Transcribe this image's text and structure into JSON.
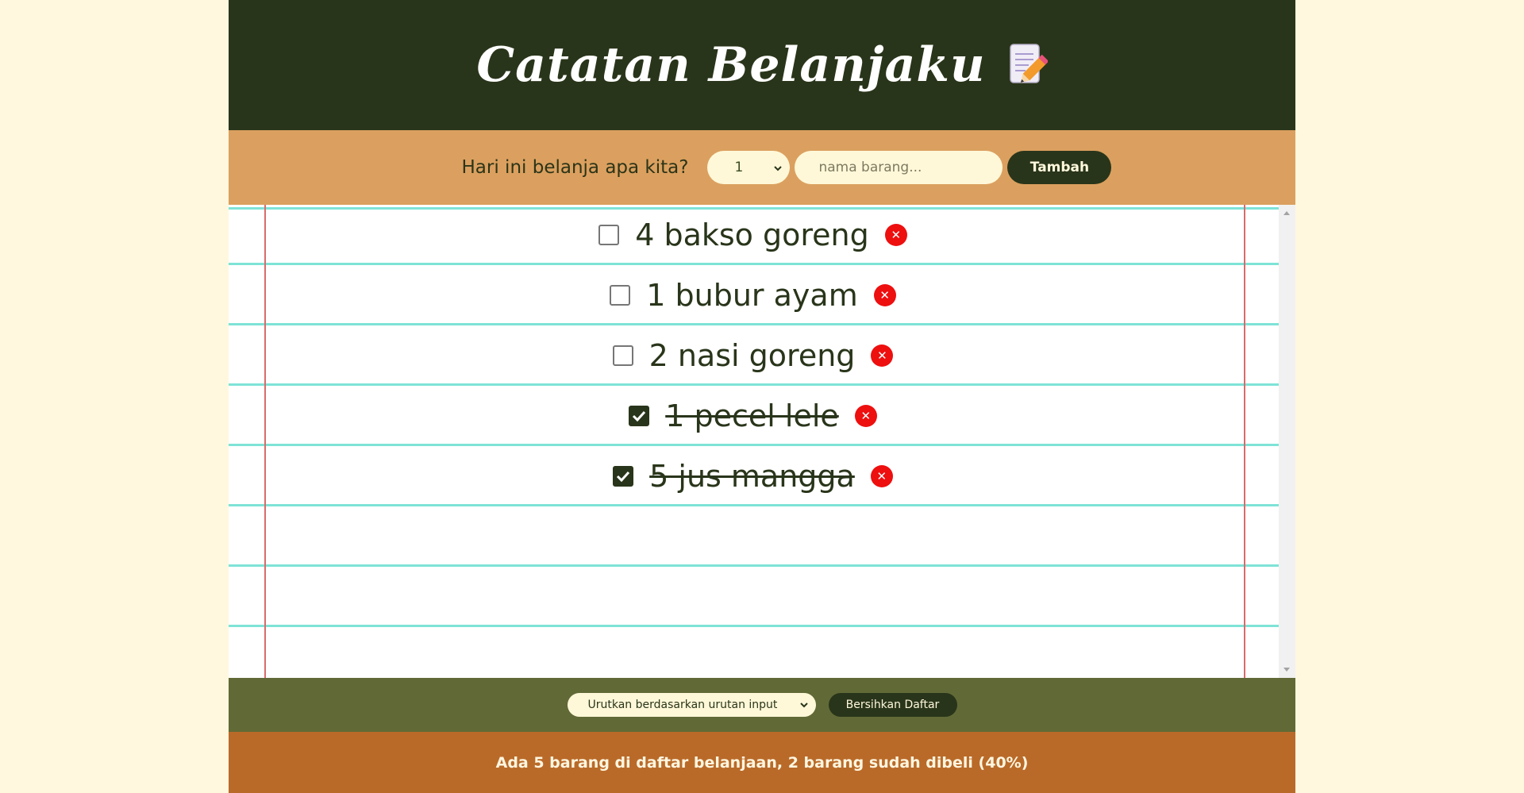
{
  "header": {
    "title": "Catatan Belanjaku",
    "icon": "memo-pencil-icon"
  },
  "form": {
    "prompt": "Hari ini belanja apa kita?",
    "quantity_selected": "1",
    "name_placeholder": "nama barang...",
    "add_label": "Tambah"
  },
  "items": [
    {
      "text": "4 bakso goreng",
      "checked": false
    },
    {
      "text": "1 bubur ayam",
      "checked": false
    },
    {
      "text": "2 nasi goreng",
      "checked": false
    },
    {
      "text": "1 pecel lele",
      "checked": true
    },
    {
      "text": "5 jus mangga",
      "checked": true
    }
  ],
  "tools": {
    "sort_selected": "Urutkan berdasarkan urutan input",
    "clear_label": "Bersihkan Daftar"
  },
  "footer": {
    "stats": "Ada 5 barang di daftar belanjaan, 2 barang sudah dibeli (40%)"
  },
  "colors": {
    "header_bg": "#29351a",
    "form_bg": "#dba05f",
    "tools_bg": "#616a37",
    "footer_bg": "#b96a29",
    "delete_red": "#ee0f0f",
    "paper_line": "#7ee3d7",
    "margin_line": "#d96b6b"
  }
}
